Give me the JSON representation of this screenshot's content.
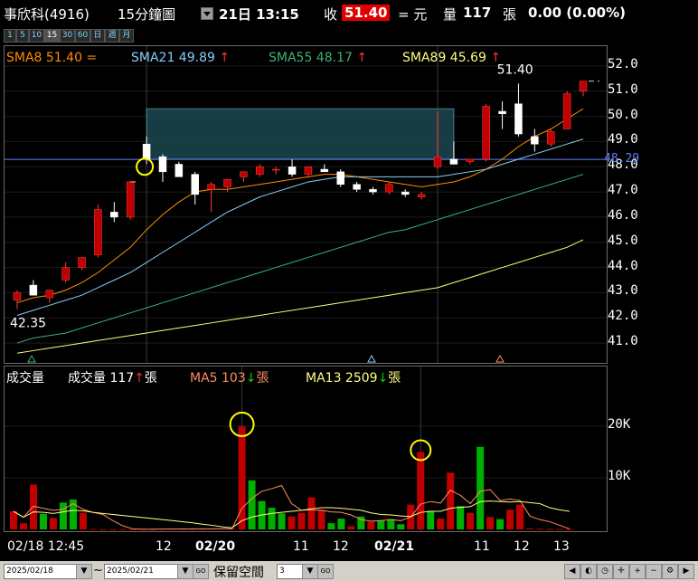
{
  "header": {
    "symbol": "事欣科(4916)",
    "period": "15分鐘圖",
    "datetime": "21日 13:15",
    "close_label": "收",
    "close_value": "51.40",
    "change_label": "= 元",
    "vol_label": "量",
    "vol_value": "117",
    "vol_unit": "張",
    "change": "0.00 (0.00%)"
  },
  "period_buttons": [
    "1",
    "5",
    "10",
    "15",
    "30",
    "60",
    "日",
    "週",
    "月"
  ],
  "price_legend": {
    "sma8": "SMA8 51.40 =",
    "sma21": "SMA21 49.89",
    "sma55": "SMA55 48.17",
    "sma89": "SMA89 45.69",
    "arrow": "↑"
  },
  "volume_legend": {
    "title": "成交量",
    "vol": "成交量 117",
    "ma5": "MA5 103",
    "ma13": "MA13 2509",
    "unit": "張",
    "up": "↑",
    "down": "↓"
  },
  "colors": {
    "up": "#c00000",
    "down": "#ffffff",
    "sma8": "#ff8c00",
    "sma21": "#87cefa",
    "sma55": "#3cb371",
    "sma89": "#ffff80",
    "vol_up": "#c00000",
    "vol_down": "#00b000",
    "box": "#1e4b55",
    "marker": "#ffff00"
  },
  "footer": {
    "date_from": "2025/02/18",
    "tilde": "~",
    "date_to": "2025/02/21",
    "reserve_label": "保留空間",
    "reserve_value": "3",
    "go": "GO"
  },
  "chart_data": [
    {
      "type": "candlestick",
      "title": "",
      "ylim": [
        40.5,
        52.5
      ],
      "yticks": [
        "52.0",
        "51.0",
        "50.0",
        "49.0",
        "48.0",
        "47.0",
        "46.0",
        "45.0",
        "44.0",
        "43.0",
        "42.0",
        "41.0"
      ],
      "current_price_line": "48.29",
      "annotations": [
        "51.40",
        "42.35"
      ],
      "x_labels": [
        "02/18 12:45",
        "12",
        "02/20",
        "11",
        "12",
        "02/21",
        "11",
        "12",
        "13"
      ],
      "candles": [
        {
          "o": 42.7,
          "h": 43.1,
          "l": 42.35,
          "c": 43.0
        },
        {
          "o": 43.3,
          "h": 43.5,
          "l": 42.9,
          "c": 42.9
        },
        {
          "o": 42.8,
          "h": 43.1,
          "l": 42.6,
          "c": 43.1
        },
        {
          "o": 43.5,
          "h": 44.2,
          "l": 43.4,
          "c": 44.0
        },
        {
          "o": 44.0,
          "h": 44.4,
          "l": 43.9,
          "c": 44.4
        },
        {
          "o": 44.5,
          "h": 46.5,
          "l": 44.4,
          "c": 46.3
        },
        {
          "o": 46.2,
          "h": 46.6,
          "l": 45.8,
          "c": 46.0
        },
        {
          "o": 46.0,
          "h": 47.4,
          "l": 45.9,
          "c": 47.4
        },
        {
          "o": 48.9,
          "h": 49.2,
          "l": 48.1,
          "c": 48.3
        },
        {
          "o": 48.4,
          "h": 48.5,
          "l": 47.4,
          "c": 47.8
        },
        {
          "o": 48.1,
          "h": 48.2,
          "l": 47.6,
          "c": 47.6
        },
        {
          "o": 47.7,
          "h": 47.8,
          "l": 46.5,
          "c": 46.9
        },
        {
          "o": 47.1,
          "h": 47.4,
          "l": 46.2,
          "c": 47.3
        },
        {
          "o": 47.2,
          "h": 47.5,
          "l": 47.0,
          "c": 47.5
        },
        {
          "o": 47.6,
          "h": 47.8,
          "l": 47.4,
          "c": 47.8
        },
        {
          "o": 47.7,
          "h": 48.1,
          "l": 47.6,
          "c": 48.0
        },
        {
          "o": 47.9,
          "h": 48.0,
          "l": 47.7,
          "c": 47.9
        },
        {
          "o": 48.0,
          "h": 48.3,
          "l": 47.6,
          "c": 47.7
        },
        {
          "o": 47.7,
          "h": 48.0,
          "l": 47.6,
          "c": 48.0
        },
        {
          "o": 47.9,
          "h": 48.1,
          "l": 47.8,
          "c": 47.8
        },
        {
          "o": 47.8,
          "h": 47.9,
          "l": 47.2,
          "c": 47.3
        },
        {
          "o": 47.3,
          "h": 47.4,
          "l": 47.0,
          "c": 47.1
        },
        {
          "o": 47.1,
          "h": 47.2,
          "l": 46.9,
          "c": 47.0
        },
        {
          "o": 47.0,
          "h": 47.4,
          "l": 46.9,
          "c": 47.3
        },
        {
          "o": 47.0,
          "h": 47.1,
          "l": 46.8,
          "c": 46.9
        },
        {
          "o": 46.8,
          "h": 47.0,
          "l": 46.7,
          "c": 46.9
        },
        {
          "o": 48.0,
          "h": 50.2,
          "l": 47.9,
          "c": 48.4
        },
        {
          "o": 48.3,
          "h": 49.0,
          "l": 48.1,
          "c": 48.1
        },
        {
          "o": 48.2,
          "h": 48.3,
          "l": 48.1,
          "c": 48.3
        },
        {
          "o": 48.3,
          "h": 50.5,
          "l": 48.2,
          "c": 50.4
        },
        {
          "o": 50.2,
          "h": 50.6,
          "l": 49.5,
          "c": 50.1
        },
        {
          "o": 50.5,
          "h": 51.3,
          "l": 49.2,
          "c": 49.3
        },
        {
          "o": 49.2,
          "h": 49.5,
          "l": 48.6,
          "c": 48.9
        },
        {
          "o": 48.9,
          "h": 49.5,
          "l": 48.8,
          "c": 49.4
        },
        {
          "o": 49.5,
          "h": 51.0,
          "l": 49.5,
          "c": 50.9
        },
        {
          "o": 51.0,
          "h": 51.4,
          "l": 50.8,
          "c": 51.4
        }
      ],
      "series": [
        {
          "name": "SMA8",
          "values": [
            42.6,
            42.8,
            42.9,
            43.1,
            43.4,
            43.8,
            44.3,
            44.8,
            45.5,
            46.1,
            46.6,
            47.0,
            47.1,
            47.1,
            47.2,
            47.3,
            47.4,
            47.5,
            47.6,
            47.7,
            47.7,
            47.6,
            47.5,
            47.4,
            47.3,
            47.2,
            47.3,
            47.4,
            47.6,
            47.9,
            48.3,
            48.8,
            49.2,
            49.5,
            49.9,
            50.3
          ]
        },
        {
          "name": "SMA21",
          "values": [
            42.1,
            42.3,
            42.5,
            42.7,
            42.9,
            43.2,
            43.5,
            43.8,
            44.2,
            44.6,
            45.0,
            45.4,
            45.8,
            46.2,
            46.5,
            46.8,
            47.0,
            47.2,
            47.4,
            47.5,
            47.6,
            47.6,
            47.6,
            47.6,
            47.6,
            47.6,
            47.6,
            47.7,
            47.8,
            47.9,
            48.1,
            48.3,
            48.5,
            48.7,
            48.9,
            49.1
          ]
        },
        {
          "name": "SMA55",
          "values": [
            41.0,
            41.2,
            41.3,
            41.4,
            41.6,
            41.8,
            42.0,
            42.2,
            42.4,
            42.6,
            42.8,
            43.0,
            43.2,
            43.4,
            43.6,
            43.8,
            44.0,
            44.2,
            44.4,
            44.6,
            44.8,
            45.0,
            45.2,
            45.4,
            45.5,
            45.7,
            45.9,
            46.1,
            46.3,
            46.5,
            46.7,
            46.9,
            47.1,
            47.3,
            47.5,
            47.7
          ]
        },
        {
          "name": "SMA89",
          "values": [
            40.6,
            40.7,
            40.8,
            40.9,
            41.0,
            41.1,
            41.2,
            41.3,
            41.4,
            41.5,
            41.6,
            41.7,
            41.8,
            41.9,
            42.0,
            42.1,
            42.2,
            42.3,
            42.4,
            42.5,
            42.6,
            42.7,
            42.8,
            42.9,
            43.0,
            43.1,
            43.2,
            43.4,
            43.6,
            43.8,
            44.0,
            44.2,
            44.4,
            44.6,
            44.8,
            45.1
          ]
        }
      ]
    },
    {
      "type": "bar",
      "title": "",
      "ylim": [
        0,
        27000
      ],
      "yticks": [
        "20K",
        "10K"
      ],
      "values": [
        3500,
        1200,
        8700,
        3000,
        2200,
        5200,
        5800,
        3200,
        100,
        50,
        50,
        50,
        50,
        50,
        50,
        100,
        100,
        100,
        100,
        100,
        150,
        200,
        150,
        20000,
        9500,
        5500,
        4200,
        3100,
        2500,
        3200,
        6200,
        3800,
        1200,
        2100,
        600,
        2500,
        1500,
        1800,
        2000,
        1000,
        4800,
        15000,
        3600,
        2100,
        11000,
        4500,
        3200,
        16000,
        2400,
        2000,
        3800,
        4800,
        200,
        150,
        100,
        80,
        60
      ],
      "up": [
        true,
        true,
        true,
        false,
        true,
        false,
        false,
        true,
        true,
        true,
        true,
        true,
        true,
        true,
        true,
        true,
        true,
        true,
        true,
        true,
        true,
        true,
        true,
        true,
        false,
        false,
        false,
        false,
        true,
        true,
        true,
        true,
        false,
        false,
        true,
        false,
        true,
        false,
        false,
        false,
        true,
        true,
        false,
        true,
        true,
        false,
        true,
        false,
        true,
        false,
        true,
        true,
        true,
        true,
        true,
        true,
        true
      ],
      "series": [
        {
          "name": "MA5",
          "values": [
            3500,
            2350,
            4500,
            4100,
            3700,
            3900,
            5000,
            3900,
            3300,
            2900,
            1700,
            700,
            100,
            50,
            50,
            60,
            80,
            90,
            100,
            100,
            110,
            130,
            140,
            4100,
            6000,
            7400,
            7900,
            8500,
            5000,
            3700,
            3800,
            3700,
            3400,
            3300,
            2800,
            1900,
            1600,
            1700,
            1900,
            1700,
            2400,
            4900,
            5400,
            5100,
            7600,
            6600,
            5000,
            7400,
            7700,
            5600,
            5900,
            5600,
            2600,
            1900,
            1500,
            800,
            100
          ]
        },
        {
          "name": "MA13",
          "values": [
            3500,
            2350,
            3400,
            3300,
            3100,
            3400,
            3700,
            3600,
            3300,
            3100,
            2900,
            2700,
            2500,
            2300,
            2100,
            1900,
            1700,
            1500,
            1300,
            1000,
            800,
            500,
            300,
            1700,
            2400,
            2800,
            3100,
            3300,
            3500,
            3700,
            4000,
            4200,
            4200,
            4100,
            3900,
            3700,
            3200,
            2900,
            2800,
            2600,
            2500,
            3300,
            3500,
            3500,
            4100,
            4300,
            4400,
            5400,
            5500,
            5400,
            5300,
            5400,
            5200,
            5000,
            4200,
            3800,
            3500
          ]
        }
      ],
      "markers": [
        "20K bar at 02/20 open",
        "15K bar at 02/21 open"
      ]
    }
  ]
}
